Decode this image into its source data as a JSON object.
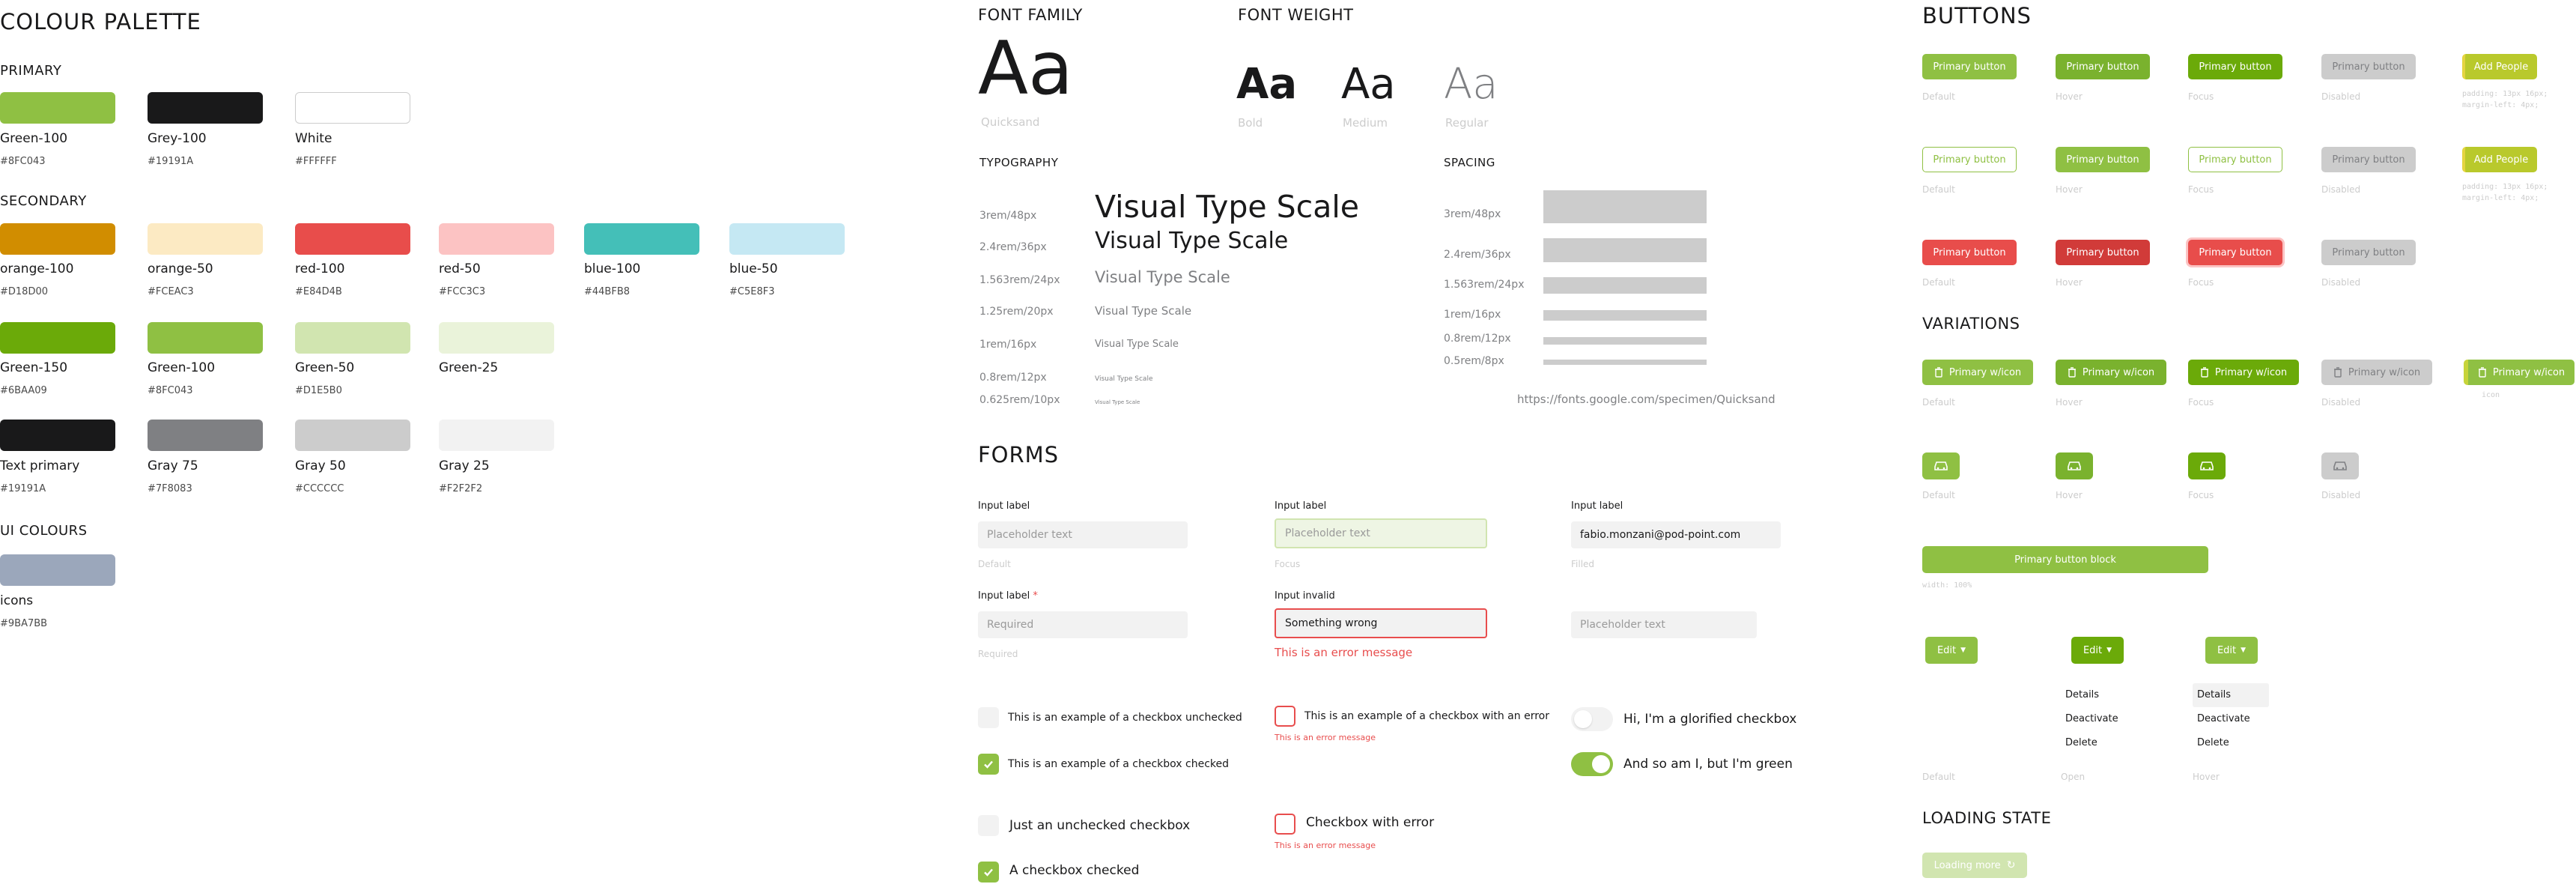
{
  "colours": {
    "title": "COLOUR PALETTE",
    "primary_title": "PRIMARY",
    "secondary_title": "SECONDARY",
    "ui_title": "UI COLOURS",
    "primary": [
      {
        "name": "Green-100",
        "hex": "#8FC043",
        "color": "#8FC043"
      },
      {
        "name": "Grey-100",
        "hex": "#19191A",
        "color": "#19191A"
      },
      {
        "name": "White",
        "hex": "#FFFFFF",
        "color": "#FFFFFF"
      }
    ],
    "secondary": [
      {
        "name": "orange-100",
        "hex": "#D18D00",
        "color": "#D18D00"
      },
      {
        "name": "orange-50",
        "hex": "#FCEAC3",
        "color": "#FCEAC3"
      },
      {
        "name": "red-100",
        "hex": "#E84D4B",
        "color": "#E84D4B"
      },
      {
        "name": "red-50",
        "hex": "#FCC3C3",
        "color": "#FCC3C3"
      },
      {
        "name": "blue-100",
        "hex": "#44BFB8",
        "color": "#44BFB8"
      },
      {
        "name": "blue-50",
        "hex": "#C5E8F3",
        "color": "#C5E8F3"
      },
      {
        "name": "Green-150",
        "hex": "#6BAA09",
        "color": "#6BAA09"
      },
      {
        "name": "Green-100",
        "hex": "#8FC043",
        "color": "#8FC043"
      },
      {
        "name": "Green-50",
        "hex": "#D1E5B0",
        "color": "#D1E5B0"
      },
      {
        "name": "Green-25",
        "hex": "#EAF3DA",
        "color": "#EAF3DA"
      },
      {
        "name": "Text primary",
        "hex": "#19191A",
        "color": "#19191A"
      },
      {
        "name": "Gray 75",
        "hex": "#7F8083",
        "color": "#7F8083"
      },
      {
        "name": "Gray 50",
        "hex": "#CCCCCC",
        "color": "#CCCCCC"
      },
      {
        "name": "Gray 25",
        "hex": "#F2F2F2",
        "color": "#F2F2F2"
      }
    ],
    "ui": [
      {
        "name": "icons",
        "hex": "#9BA7BB",
        "color": "#9BA7BB"
      }
    ]
  },
  "font": {
    "family_title": "FONT FAMILY",
    "weight_title": "FONT WEIGHT",
    "sample": "Aa",
    "family_name": "Quicksand",
    "weights": [
      "Bold",
      "Medium",
      "Regular"
    ]
  },
  "typography": {
    "title": "TYPOGRAPHY",
    "sizes": [
      "3rem/48px",
      "2.4rem/36px",
      "1.563rem/24px",
      "1.25rem/20px",
      "1rem/16px",
      "0.8rem/12px",
      "0.625rem/10px"
    ],
    "sample": "Visual Type Scale"
  },
  "spacing": {
    "title": "SPACING",
    "sizes": [
      "3rem/48px",
      "2.4rem/36px",
      "1.563rem/24px",
      "1rem/16px",
      "0.8rem/12px",
      "0.5rem/8px"
    ],
    "link": "https://fonts.google.com/specimen/Quicksand"
  },
  "forms": {
    "title": "FORMS",
    "input_label": "Input label",
    "required_label": "Input label",
    "required_mark": "*",
    "invalid_label": "Input invalid",
    "placeholder": "Placeholder text",
    "required_placeholder": "Required",
    "filled_value": "fabio.monzani@pod-point.com",
    "invalid_value": "Something wrong",
    "error_message": "This is an error message",
    "states": {
      "default": "Default",
      "focus": "Focus",
      "filled": "Filled",
      "required": "Required"
    },
    "checkboxes": {
      "unchecked": "This is an example of a checkbox unchecked",
      "checked": "This is an example of a checkbox checked",
      "error": "This is an example of a checkbox with an error",
      "error_msg": "This is an error message",
      "toggle_off": "Hi, I'm a glorified checkbox",
      "toggle_on": "And so am I, but I'm green",
      "just_unchecked": "Just an unchecked checkbox",
      "with_error": "Checkbox with error",
      "checked_simple": "A checkbox checked"
    }
  },
  "buttons": {
    "title": "BUTTONS",
    "primary": "Primary button",
    "add_people": "Add People",
    "padding_note": "padding: 13px 16px; margin-left: 4px;",
    "states": [
      "Default",
      "Hover",
      "Focus",
      "Disabled"
    ],
    "variations_title": "VARIATIONS",
    "with_icon": "Primary w/icon",
    "icon_note": "icon",
    "block": "Primary button block",
    "block_note": "width: 100%",
    "edit": "Edit",
    "menu": [
      "Details",
      "Deactivate",
      "Delete"
    ],
    "edit_states": [
      "Default",
      "Open",
      "Hover"
    ],
    "loading_title": "LOADING STATE",
    "loading": "Loading more"
  },
  "colors": {
    "green": "#8FC043",
    "green_dark": "#6BAA09",
    "red": "#E84D4B",
    "red_dark": "#D13B39",
    "gray": "#CCCCCC",
    "gray_text": "#7F8083",
    "yellowgreen": "#C7D43A"
  }
}
